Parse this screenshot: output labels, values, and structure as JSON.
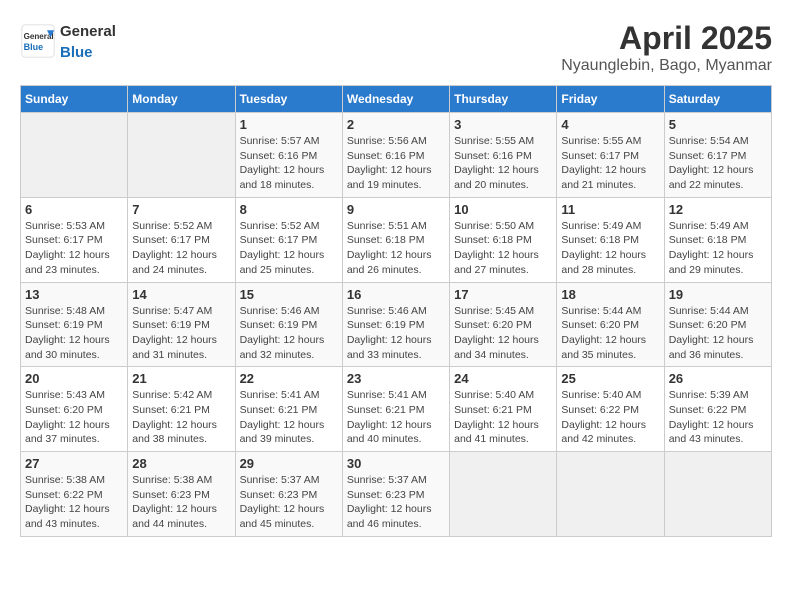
{
  "logo": {
    "general": "General",
    "blue": "Blue"
  },
  "title": "April 2025",
  "subtitle": "Nyaunglebin, Bago, Myanmar",
  "weekdays": [
    "Sunday",
    "Monday",
    "Tuesday",
    "Wednesday",
    "Thursday",
    "Friday",
    "Saturday"
  ],
  "weeks": [
    [
      {
        "day": "",
        "info": ""
      },
      {
        "day": "",
        "info": ""
      },
      {
        "day": "1",
        "info": "Sunrise: 5:57 AM\nSunset: 6:16 PM\nDaylight: 12 hours and 18 minutes."
      },
      {
        "day": "2",
        "info": "Sunrise: 5:56 AM\nSunset: 6:16 PM\nDaylight: 12 hours and 19 minutes."
      },
      {
        "day": "3",
        "info": "Sunrise: 5:55 AM\nSunset: 6:16 PM\nDaylight: 12 hours and 20 minutes."
      },
      {
        "day": "4",
        "info": "Sunrise: 5:55 AM\nSunset: 6:17 PM\nDaylight: 12 hours and 21 minutes."
      },
      {
        "day": "5",
        "info": "Sunrise: 5:54 AM\nSunset: 6:17 PM\nDaylight: 12 hours and 22 minutes."
      }
    ],
    [
      {
        "day": "6",
        "info": "Sunrise: 5:53 AM\nSunset: 6:17 PM\nDaylight: 12 hours and 23 minutes."
      },
      {
        "day": "7",
        "info": "Sunrise: 5:52 AM\nSunset: 6:17 PM\nDaylight: 12 hours and 24 minutes."
      },
      {
        "day": "8",
        "info": "Sunrise: 5:52 AM\nSunset: 6:17 PM\nDaylight: 12 hours and 25 minutes."
      },
      {
        "day": "9",
        "info": "Sunrise: 5:51 AM\nSunset: 6:18 PM\nDaylight: 12 hours and 26 minutes."
      },
      {
        "day": "10",
        "info": "Sunrise: 5:50 AM\nSunset: 6:18 PM\nDaylight: 12 hours and 27 minutes."
      },
      {
        "day": "11",
        "info": "Sunrise: 5:49 AM\nSunset: 6:18 PM\nDaylight: 12 hours and 28 minutes."
      },
      {
        "day": "12",
        "info": "Sunrise: 5:49 AM\nSunset: 6:18 PM\nDaylight: 12 hours and 29 minutes."
      }
    ],
    [
      {
        "day": "13",
        "info": "Sunrise: 5:48 AM\nSunset: 6:19 PM\nDaylight: 12 hours and 30 minutes."
      },
      {
        "day": "14",
        "info": "Sunrise: 5:47 AM\nSunset: 6:19 PM\nDaylight: 12 hours and 31 minutes."
      },
      {
        "day": "15",
        "info": "Sunrise: 5:46 AM\nSunset: 6:19 PM\nDaylight: 12 hours and 32 minutes."
      },
      {
        "day": "16",
        "info": "Sunrise: 5:46 AM\nSunset: 6:19 PM\nDaylight: 12 hours and 33 minutes."
      },
      {
        "day": "17",
        "info": "Sunrise: 5:45 AM\nSunset: 6:20 PM\nDaylight: 12 hours and 34 minutes."
      },
      {
        "day": "18",
        "info": "Sunrise: 5:44 AM\nSunset: 6:20 PM\nDaylight: 12 hours and 35 minutes."
      },
      {
        "day": "19",
        "info": "Sunrise: 5:44 AM\nSunset: 6:20 PM\nDaylight: 12 hours and 36 minutes."
      }
    ],
    [
      {
        "day": "20",
        "info": "Sunrise: 5:43 AM\nSunset: 6:20 PM\nDaylight: 12 hours and 37 minutes."
      },
      {
        "day": "21",
        "info": "Sunrise: 5:42 AM\nSunset: 6:21 PM\nDaylight: 12 hours and 38 minutes."
      },
      {
        "day": "22",
        "info": "Sunrise: 5:41 AM\nSunset: 6:21 PM\nDaylight: 12 hours and 39 minutes."
      },
      {
        "day": "23",
        "info": "Sunrise: 5:41 AM\nSunset: 6:21 PM\nDaylight: 12 hours and 40 minutes."
      },
      {
        "day": "24",
        "info": "Sunrise: 5:40 AM\nSunset: 6:21 PM\nDaylight: 12 hours and 41 minutes."
      },
      {
        "day": "25",
        "info": "Sunrise: 5:40 AM\nSunset: 6:22 PM\nDaylight: 12 hours and 42 minutes."
      },
      {
        "day": "26",
        "info": "Sunrise: 5:39 AM\nSunset: 6:22 PM\nDaylight: 12 hours and 43 minutes."
      }
    ],
    [
      {
        "day": "27",
        "info": "Sunrise: 5:38 AM\nSunset: 6:22 PM\nDaylight: 12 hours and 43 minutes."
      },
      {
        "day": "28",
        "info": "Sunrise: 5:38 AM\nSunset: 6:23 PM\nDaylight: 12 hours and 44 minutes."
      },
      {
        "day": "29",
        "info": "Sunrise: 5:37 AM\nSunset: 6:23 PM\nDaylight: 12 hours and 45 minutes."
      },
      {
        "day": "30",
        "info": "Sunrise: 5:37 AM\nSunset: 6:23 PM\nDaylight: 12 hours and 46 minutes."
      },
      {
        "day": "",
        "info": ""
      },
      {
        "day": "",
        "info": ""
      },
      {
        "day": "",
        "info": ""
      }
    ]
  ]
}
